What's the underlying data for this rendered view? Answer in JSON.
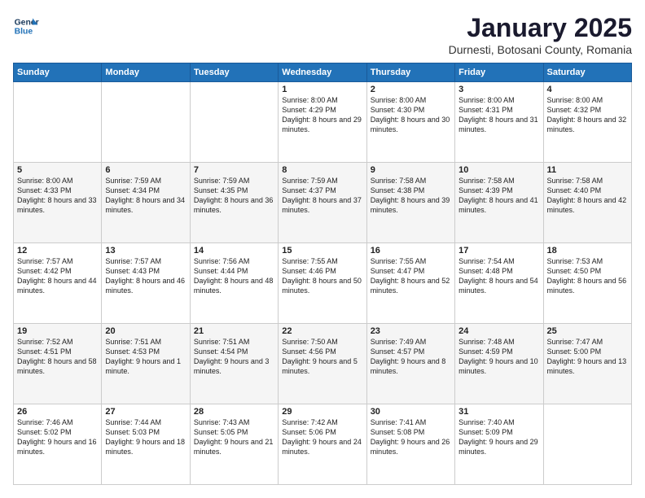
{
  "header": {
    "logo_line1": "General",
    "logo_line2": "Blue",
    "title": "January 2025",
    "subtitle": "Durnesti, Botosani County, Romania"
  },
  "days_of_week": [
    "Sunday",
    "Monday",
    "Tuesday",
    "Wednesday",
    "Thursday",
    "Friday",
    "Saturday"
  ],
  "weeks": [
    [
      {
        "day": "",
        "info": ""
      },
      {
        "day": "",
        "info": ""
      },
      {
        "day": "",
        "info": ""
      },
      {
        "day": "1",
        "info": "Sunrise: 8:00 AM\nSunset: 4:29 PM\nDaylight: 8 hours\nand 29 minutes."
      },
      {
        "day": "2",
        "info": "Sunrise: 8:00 AM\nSunset: 4:30 PM\nDaylight: 8 hours\nand 30 minutes."
      },
      {
        "day": "3",
        "info": "Sunrise: 8:00 AM\nSunset: 4:31 PM\nDaylight: 8 hours\nand 31 minutes."
      },
      {
        "day": "4",
        "info": "Sunrise: 8:00 AM\nSunset: 4:32 PM\nDaylight: 8 hours\nand 32 minutes."
      }
    ],
    [
      {
        "day": "5",
        "info": "Sunrise: 8:00 AM\nSunset: 4:33 PM\nDaylight: 8 hours\nand 33 minutes."
      },
      {
        "day": "6",
        "info": "Sunrise: 7:59 AM\nSunset: 4:34 PM\nDaylight: 8 hours\nand 34 minutes."
      },
      {
        "day": "7",
        "info": "Sunrise: 7:59 AM\nSunset: 4:35 PM\nDaylight: 8 hours\nand 36 minutes."
      },
      {
        "day": "8",
        "info": "Sunrise: 7:59 AM\nSunset: 4:37 PM\nDaylight: 8 hours\nand 37 minutes."
      },
      {
        "day": "9",
        "info": "Sunrise: 7:58 AM\nSunset: 4:38 PM\nDaylight: 8 hours\nand 39 minutes."
      },
      {
        "day": "10",
        "info": "Sunrise: 7:58 AM\nSunset: 4:39 PM\nDaylight: 8 hours\nand 41 minutes."
      },
      {
        "day": "11",
        "info": "Sunrise: 7:58 AM\nSunset: 4:40 PM\nDaylight: 8 hours\nand 42 minutes."
      }
    ],
    [
      {
        "day": "12",
        "info": "Sunrise: 7:57 AM\nSunset: 4:42 PM\nDaylight: 8 hours\nand 44 minutes."
      },
      {
        "day": "13",
        "info": "Sunrise: 7:57 AM\nSunset: 4:43 PM\nDaylight: 8 hours\nand 46 minutes."
      },
      {
        "day": "14",
        "info": "Sunrise: 7:56 AM\nSunset: 4:44 PM\nDaylight: 8 hours\nand 48 minutes."
      },
      {
        "day": "15",
        "info": "Sunrise: 7:55 AM\nSunset: 4:46 PM\nDaylight: 8 hours\nand 50 minutes."
      },
      {
        "day": "16",
        "info": "Sunrise: 7:55 AM\nSunset: 4:47 PM\nDaylight: 8 hours\nand 52 minutes."
      },
      {
        "day": "17",
        "info": "Sunrise: 7:54 AM\nSunset: 4:48 PM\nDaylight: 8 hours\nand 54 minutes."
      },
      {
        "day": "18",
        "info": "Sunrise: 7:53 AM\nSunset: 4:50 PM\nDaylight: 8 hours\nand 56 minutes."
      }
    ],
    [
      {
        "day": "19",
        "info": "Sunrise: 7:52 AM\nSunset: 4:51 PM\nDaylight: 8 hours\nand 58 minutes."
      },
      {
        "day": "20",
        "info": "Sunrise: 7:51 AM\nSunset: 4:53 PM\nDaylight: 9 hours\nand 1 minute."
      },
      {
        "day": "21",
        "info": "Sunrise: 7:51 AM\nSunset: 4:54 PM\nDaylight: 9 hours\nand 3 minutes."
      },
      {
        "day": "22",
        "info": "Sunrise: 7:50 AM\nSunset: 4:56 PM\nDaylight: 9 hours\nand 5 minutes."
      },
      {
        "day": "23",
        "info": "Sunrise: 7:49 AM\nSunset: 4:57 PM\nDaylight: 9 hours\nand 8 minutes."
      },
      {
        "day": "24",
        "info": "Sunrise: 7:48 AM\nSunset: 4:59 PM\nDaylight: 9 hours\nand 10 minutes."
      },
      {
        "day": "25",
        "info": "Sunrise: 7:47 AM\nSunset: 5:00 PM\nDaylight: 9 hours\nand 13 minutes."
      }
    ],
    [
      {
        "day": "26",
        "info": "Sunrise: 7:46 AM\nSunset: 5:02 PM\nDaylight: 9 hours\nand 16 minutes."
      },
      {
        "day": "27",
        "info": "Sunrise: 7:44 AM\nSunset: 5:03 PM\nDaylight: 9 hours\nand 18 minutes."
      },
      {
        "day": "28",
        "info": "Sunrise: 7:43 AM\nSunset: 5:05 PM\nDaylight: 9 hours\nand 21 minutes."
      },
      {
        "day": "29",
        "info": "Sunrise: 7:42 AM\nSunset: 5:06 PM\nDaylight: 9 hours\nand 24 minutes."
      },
      {
        "day": "30",
        "info": "Sunrise: 7:41 AM\nSunset: 5:08 PM\nDaylight: 9 hours\nand 26 minutes."
      },
      {
        "day": "31",
        "info": "Sunrise: 7:40 AM\nSunset: 5:09 PM\nDaylight: 9 hours\nand 29 minutes."
      },
      {
        "day": "",
        "info": ""
      }
    ]
  ]
}
